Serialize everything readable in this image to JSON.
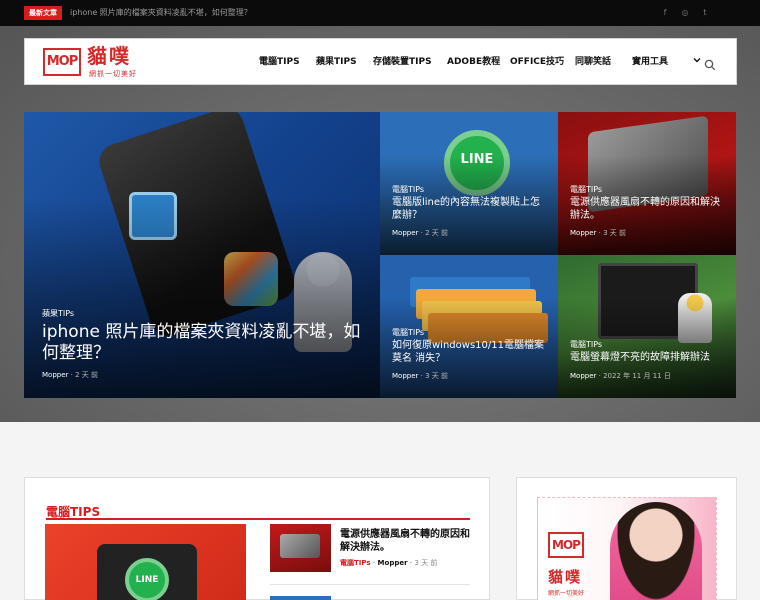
{
  "topbar": {
    "badge": "最新文章",
    "ticker": "iphone 照片庫的檔案夾資料凌亂不堪，如何整理？",
    "social_icons": [
      "facebook-icon",
      "instagram-icon",
      "twitter-icon"
    ],
    "social_glyphs": [
      "f",
      "◎",
      "t"
    ]
  },
  "logo": {
    "mark": "MOP",
    "name": "貓噗",
    "slogan": "網抓一切美好",
    "color": "#d62a2a"
  },
  "nav": {
    "items": [
      "電腦TIPS",
      "蘋果TIPS",
      "存儲裝置TIPS",
      "ADOBE教程",
      "OFFICE技巧",
      "同聊笑話",
      "實用工具"
    ],
    "more_icon": "chevron-down-icon",
    "search_icon": "search-icon"
  },
  "hero": {
    "main": {
      "category": "蘋果TIPs",
      "title": "iphone 照片庫的檔案夾資料凌亂不堪，如何整理？",
      "author": "Mopper",
      "time": "2 天 前"
    },
    "cards": [
      {
        "category": "電腦TIPs",
        "title": "電腦版line的內容無法複製貼上怎麼辦？",
        "author": "Mopper",
        "time": "2 天 前"
      },
      {
        "category": "電腦TIPs",
        "title": "電源供應器風扇不轉的原因和解決辦法。",
        "author": "Mopper",
        "time": "3 天 前"
      },
      {
        "category": "電腦TIPs",
        "title": "如何復原windows10/11電腦檔案 莫名 消失？",
        "author": "Mopper",
        "time": "3 天 前"
      },
      {
        "category": "電腦TIPs",
        "title": "電腦螢幕燈不亮的故障排解辦法",
        "author": "Mopper",
        "time": "2022 年 11 月 11 日"
      }
    ],
    "line_text": "LINE"
  },
  "section": {
    "title": "電腦TIPS",
    "side_post": {
      "title": "電源供應器風扇不轉的原因和解決辦法。",
      "category": "電腦TIPs",
      "author": "Mopper",
      "time": "3 天 前"
    }
  },
  "ad": {
    "mark": "MOP",
    "name": "貓噗",
    "slogan": "網抓一切美好"
  },
  "colors": {
    "accent": "#d81c1c",
    "topbar": "#0b0b0b"
  }
}
